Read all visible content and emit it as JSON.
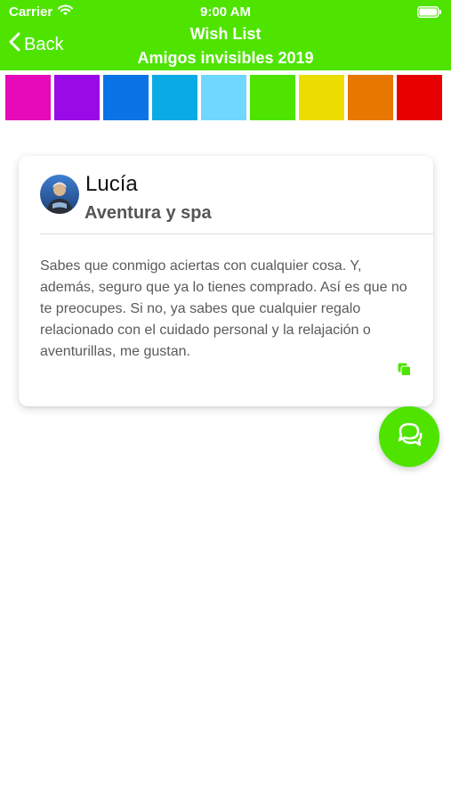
{
  "status_bar": {
    "carrier": "Carrier",
    "time": "9:00 AM",
    "wifi_icon": "wifi-icon",
    "battery_icon": "battery-icon"
  },
  "nav": {
    "back_label": "Back",
    "back_icon": "chevron-left-icon",
    "title": "Wish List",
    "subtitle": "Amigos invisibles 2019",
    "background_color": "#4ee400"
  },
  "color_swatches": [
    {
      "color": "#e60aba"
    },
    {
      "color": "#9a0ae6"
    },
    {
      "color": "#0a74e6"
    },
    {
      "color": "#0aaae6"
    },
    {
      "color": "#70d8ff"
    },
    {
      "color": "#4ee400"
    },
    {
      "color": "#ebdd00"
    },
    {
      "color": "#e87700"
    },
    {
      "color": "#e60000"
    }
  ],
  "card": {
    "name": "Lucía",
    "wish_title": "Aventura y spa",
    "description": "Sabes que conmigo aciertas con cualquier cosa. Y, además, seguro que ya lo tienes comprado. Así es que no te preocupes. Si no, ya sabes que cualquier regalo relacionado con el cuidado personal y la relajación o aventurillas, me gustan.",
    "copy_icon": "copy-icon",
    "accent_color": "#4ee400"
  },
  "fab": {
    "icon": "chat-bubbles-icon"
  }
}
